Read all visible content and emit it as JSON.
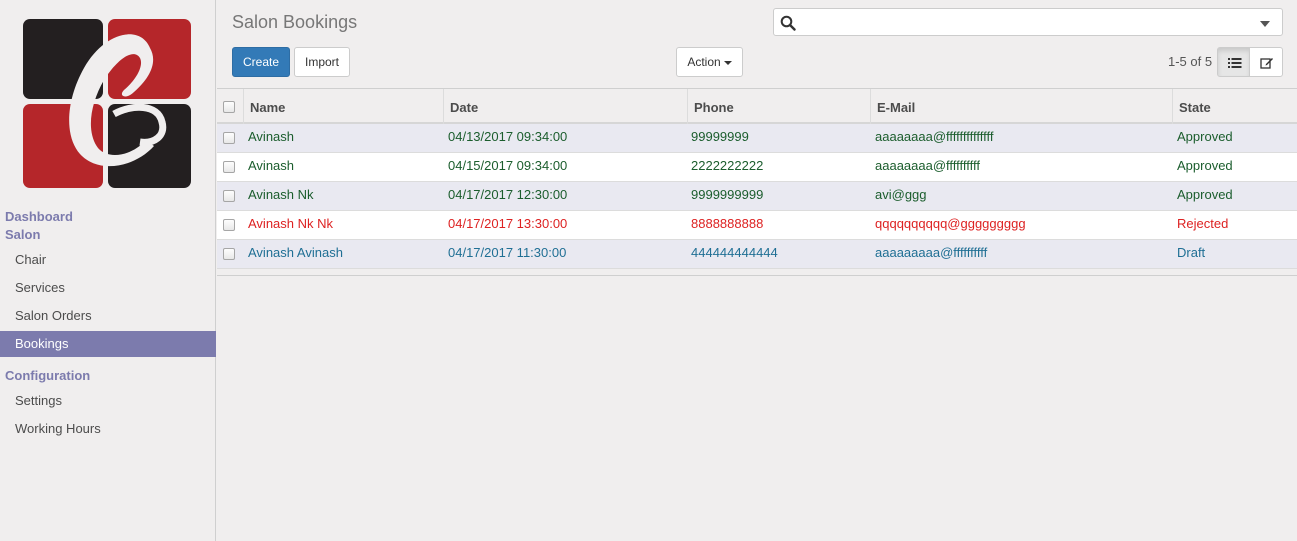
{
  "sidebar": {
    "sections": [
      {
        "label": "Dashboard"
      },
      {
        "label": "Salon"
      },
      {
        "label": "Configuration"
      }
    ],
    "salon_items": [
      {
        "label": "Chair"
      },
      {
        "label": "Services"
      },
      {
        "label": "Salon Orders"
      },
      {
        "label": "Bookings"
      }
    ],
    "config_items": [
      {
        "label": "Settings"
      },
      {
        "label": "Working Hours"
      }
    ],
    "active_item": "Bookings"
  },
  "header": {
    "title": "Salon Bookings",
    "search_placeholder": "",
    "search_value": ""
  },
  "toolbar": {
    "create_label": "Create",
    "import_label": "Import",
    "action_label": "Action",
    "pager_text": "1-5 of 5"
  },
  "table": {
    "columns": [
      "Name",
      "Date",
      "Phone",
      "E-Mail",
      "State"
    ],
    "rows": [
      {
        "name": "Avinash",
        "date": "04/13/2017 09:34:00",
        "phone": "99999999",
        "email": "aaaaaaaa@ffffffffffffff",
        "state": "Approved"
      },
      {
        "name": "Avinash",
        "date": "04/15/2017 09:34:00",
        "phone": "2222222222",
        "email": "aaaaaaaa@ffffffffff",
        "state": "Approved"
      },
      {
        "name": "Avinash Nk",
        "date": "04/17/2017 12:30:00",
        "phone": "9999999999",
        "email": "avi@ggg",
        "state": "Approved"
      },
      {
        "name": "Avinash Nk Nk",
        "date": "04/17/2017 13:30:00",
        "phone": "8888888888",
        "email": "qqqqqqqqqq@ggggggggg",
        "state": "Rejected"
      },
      {
        "name": "Avinash Avinash",
        "date": "04/17/2017 11:30:00",
        "phone": "444444444444",
        "email": "aaaaaaaaa@ffffffffff",
        "state": "Draft"
      }
    ]
  },
  "colors": {
    "brand": "#7c7bad",
    "primary_button": "#337ab7",
    "approved_text": "#1b5d2d",
    "rejected_text": "#dd2222",
    "draft_text": "#1f6f94",
    "logo_red": "#b5262a",
    "logo_dark": "#231f20"
  },
  "icons": {
    "search": "search-icon",
    "list_view": "list-view-icon",
    "form_view": "form-view-icon"
  }
}
